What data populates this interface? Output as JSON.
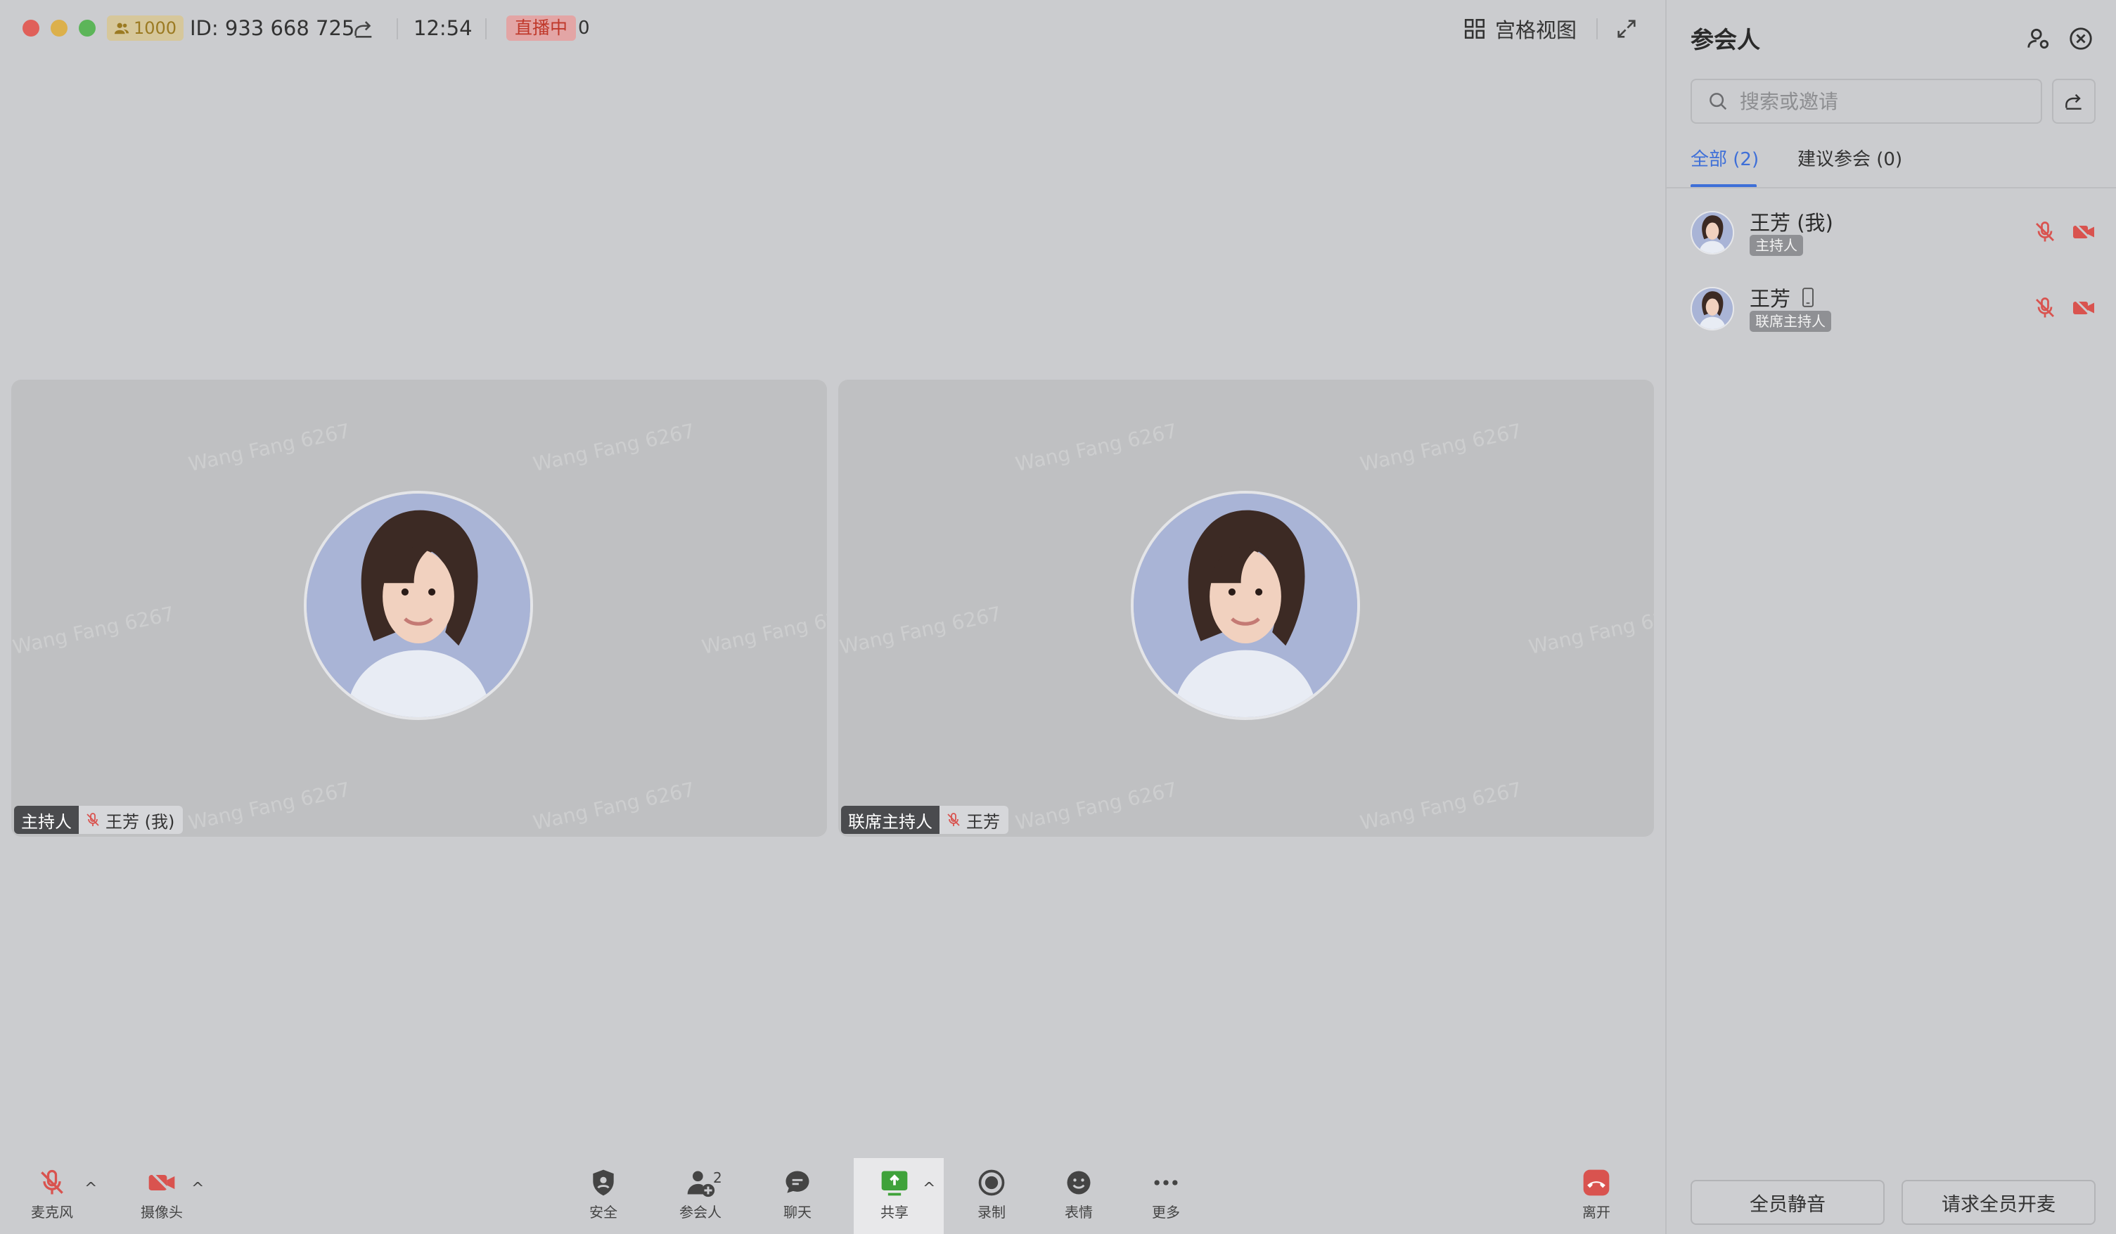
{
  "titlebar": {
    "capacity_badge": "1000",
    "meeting_id": "ID: 933 668 725",
    "clock": "12:54",
    "live_badge": "直播中",
    "live_count": "0",
    "grid_view_label": "宫格视图"
  },
  "tiles": [
    {
      "role": "主持人",
      "name": "王芳 (我)",
      "watermark": "Wang Fang 6267"
    },
    {
      "role": "联席主持人",
      "name": "王芳",
      "watermark": "Wang Fang 6267"
    }
  ],
  "toolbar": {
    "mic_label": "麦克风",
    "camera_label": "摄像头",
    "security_label": "安全",
    "participants_label": "参会人",
    "participants_count": "2",
    "chat_label": "聊天",
    "share_label": "共享",
    "record_label": "录制",
    "reactions_label": "表情",
    "more_label": "更多",
    "leave_label": "离开"
  },
  "panel": {
    "title": "参会人",
    "search_placeholder": "搜索或邀请",
    "tab_all": "全部 (2)",
    "tab_suggested": "建议参会 (0)",
    "participants": [
      {
        "name": "王芳 (我)",
        "role": "主持人",
        "mic": "muted",
        "camera": "off"
      },
      {
        "name": "王芳",
        "role": "联席主持人",
        "device": "mobile",
        "mic": "muted",
        "camera": "off"
      }
    ],
    "mute_all_label": "全员静音",
    "request_unmute_label": "请求全员开麦"
  },
  "colors": {
    "accent": "#3e6fd8",
    "danger": "#d9534f",
    "share_green": "#3fa23a",
    "background": "#cbcccf"
  }
}
